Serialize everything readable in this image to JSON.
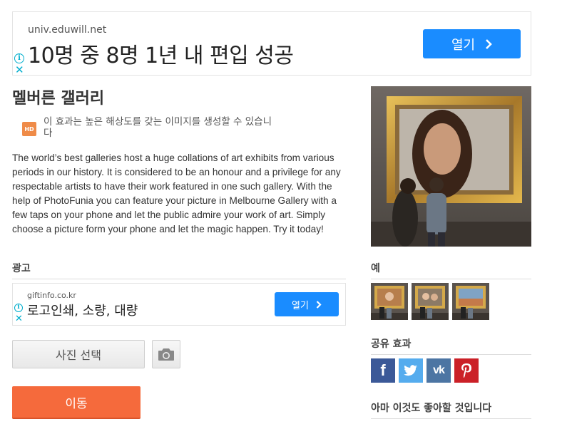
{
  "ad_top": {
    "domain": "univ.eduwill.net",
    "headline": "10명 중 8명 1년 내 편입 성공",
    "button_label": "열기"
  },
  "page": {
    "title": "멜버른 갤러리",
    "hd_badge": "HD",
    "hd_note": "이 효과는 높은 해상도를 갖는 이미지를 생성할 수 있습니다",
    "description": "The world’s best galleries host a huge collations of art exhibits from various periods in our history. It is considered to be an honour and a privilege for any respectable artists to have their work featured in one such gallery. With the help of PhotoFunia you can feature your picture in Melbourne Gallery with a few taps on your phone and let the public admire your work of art. Simply choose a picture form your phone and let the magic happen. Try it today!"
  },
  "ads_section": {
    "heading": "광고"
  },
  "ad_mid": {
    "domain": "giftinfo.co.kr",
    "headline": "로고인쇄, 소량, 대량",
    "button_label": "열기"
  },
  "actions": {
    "select_photo": "사진 선택",
    "go": "이동"
  },
  "sidebar": {
    "examples_heading": "예",
    "share_heading": "공유 효과",
    "related_heading": "아마 이것도 좋아할 것입니다",
    "share_buttons": [
      {
        "name": "facebook",
        "glyph": "f",
        "color": "#3b5998"
      },
      {
        "name": "twitter",
        "glyph": "t",
        "color": "#55acee"
      },
      {
        "name": "vk",
        "glyph": "vk",
        "color": "#4c75a3"
      },
      {
        "name": "pinterest",
        "glyph": "P",
        "color": "#cb2027"
      }
    ]
  },
  "colors": {
    "ad_button": "#1a8cff",
    "go_button": "#f56a3c",
    "hd_badge": "#ef8b48",
    "ad_icon": "#00aecd"
  }
}
